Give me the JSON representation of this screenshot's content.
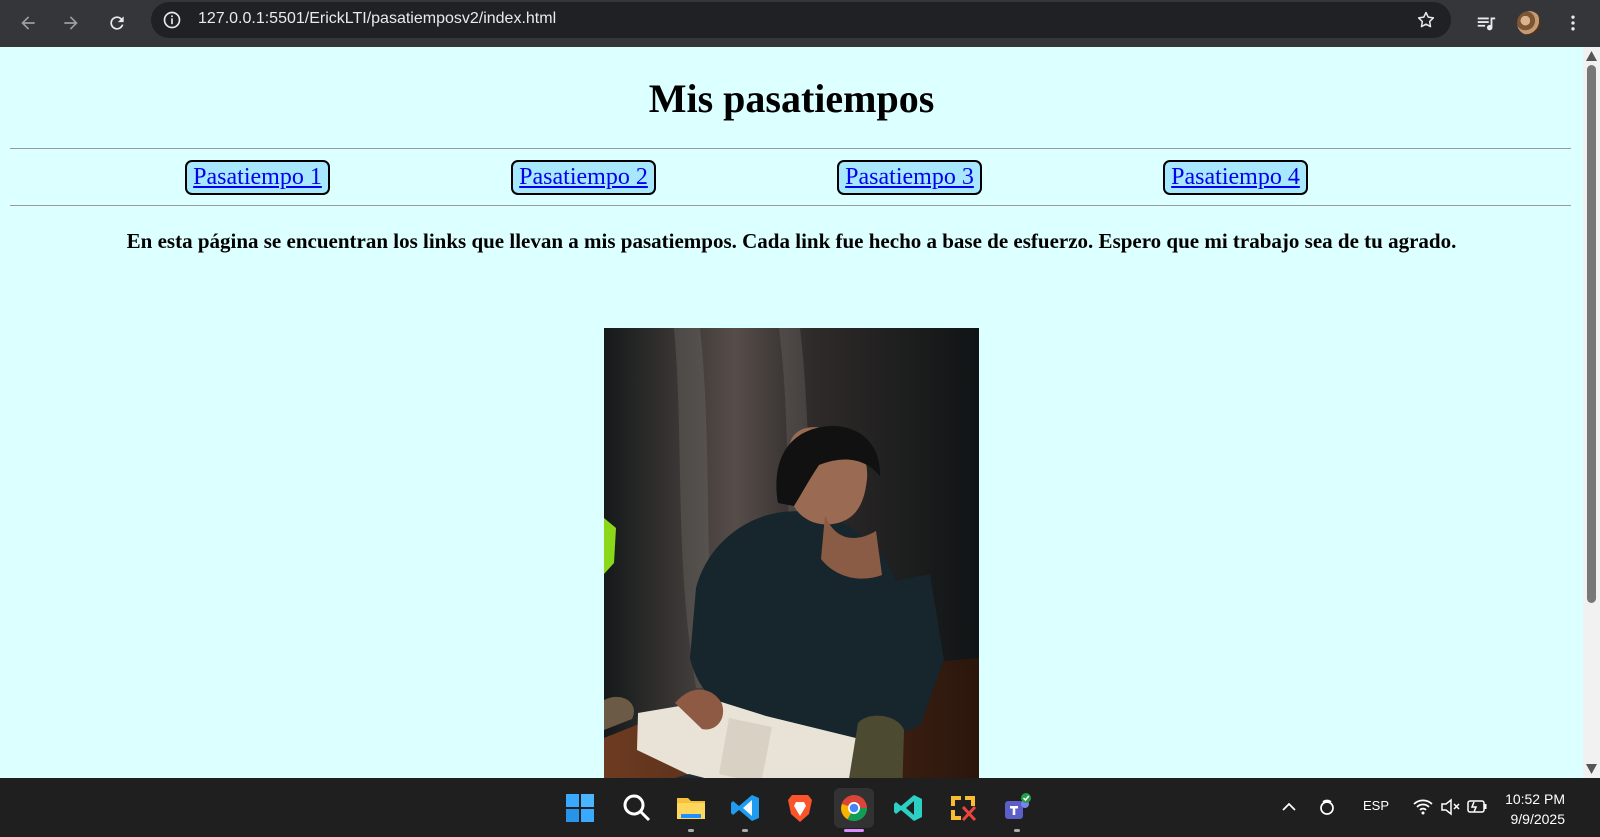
{
  "browser": {
    "url": "127.0.0.1:5501/ErickLTI/pasatiemposv2/index.html",
    "icons": [
      "back-arrow-icon",
      "forward-arrow-icon",
      "reload-icon",
      "site-info-icon",
      "bookmark-star-icon",
      "media-control-icon",
      "profile-avatar-icon",
      "menu-icon"
    ]
  },
  "page": {
    "title": "Mis pasatiempos",
    "nav": [
      {
        "label": "Pasatiempo 1"
      },
      {
        "label": "Pasatiempo 2"
      },
      {
        "label": "Pasatiempo 3"
      },
      {
        "label": "Pasatiempo 4"
      }
    ],
    "intro": "En esta página se encuentran los links que llevan a mis pasatiempos. Cada link fue hecho a base de esfuerzo. Espero que mi trabajo sea de tu agrado."
  },
  "taskbar": {
    "language": "ESP",
    "time": "10:52 PM",
    "date": "9/9/2025",
    "apps": [
      "windows-start-icon",
      "search-icon",
      "file-explorer-icon",
      "vscode-icon",
      "brave-icon",
      "chrome-icon",
      "visual-studio-icon",
      "snipping-tool-icon",
      "teams-icon"
    ]
  },
  "colors": {
    "page_background": "#dcffff",
    "link_background": "#a8e8ff",
    "link_color": "#0000ee",
    "browser_bar": "#35363a",
    "taskbar": "#1f1f20"
  }
}
